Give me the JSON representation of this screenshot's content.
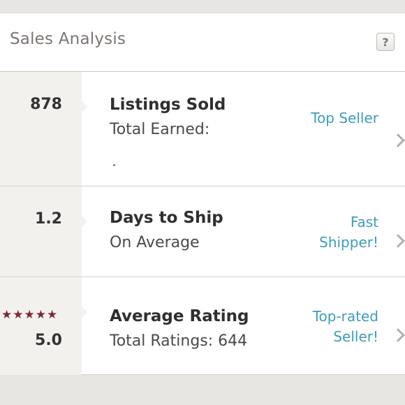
{
  "header": {
    "title": "Sales Analysis",
    "help_label": "?"
  },
  "rows": [
    {
      "stat": "878",
      "title": "Listings Sold",
      "subtitle": "Total Earned:",
      "badge_lines": [
        "Top Seller"
      ]
    },
    {
      "stat": "1.2",
      "title": "Days to Ship",
      "subtitle": "On Average",
      "badge_lines": [
        "Fast",
        "Shipper!"
      ]
    },
    {
      "stat": "5.0",
      "stars": "★★★★★",
      "title": "Average Rating",
      "subtitle": "Total Ratings: 644",
      "badge_lines": [
        "Top-rated",
        "Seller!"
      ]
    }
  ],
  "colors": {
    "accent_link": "#3e9cc0",
    "star": "#7a2a32",
    "stat_bg": "#f3f1ee"
  },
  "icons": {
    "help": "question-mark-icon",
    "row_arrow": "chevron-right-icon",
    "rating": "star-icon"
  }
}
